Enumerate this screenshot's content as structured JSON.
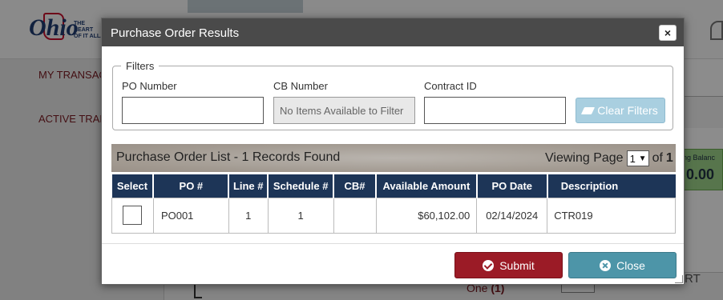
{
  "background": {
    "logo": {
      "wordmark": "Ohio",
      "tagline_lines": [
        "THE",
        "HEART",
        "OF IT ALL."
      ]
    },
    "nav_items": [
      "MY TRANSAC",
      "ACTIVE TRAN"
    ],
    "right_card": {
      "title": "ng Balanc",
      "value": "0.00"
    },
    "bottom": {
      "one_label": "One",
      "one_count": "(1)",
      "art_text": "ART"
    }
  },
  "modal": {
    "title": "Purchase Order Results",
    "close_symbol": "×",
    "filters": {
      "legend": "Filters",
      "po_number": {
        "label": "PO Number",
        "value": "",
        "placeholder": ""
      },
      "cb_number": {
        "label": "CB Number",
        "value": "No Items Available to Filter"
      },
      "contract_id": {
        "label": "Contract ID",
        "value": "",
        "placeholder": ""
      },
      "clear_button": "Clear Filters"
    },
    "list": {
      "title": "Purchase Order List - 1 Records Found",
      "viewing_label": "Viewing Page",
      "page_value": "1",
      "of_label": "of",
      "total_pages": "1"
    },
    "table": {
      "columns": [
        "Select",
        "PO #",
        "Line #",
        "Schedule #",
        "CB#",
        "Available Amount",
        "PO Date",
        "Description"
      ],
      "rows": [
        {
          "po": "PO001",
          "line": "1",
          "schedule": "1",
          "cb": "",
          "amount": "$60,102.00",
          "date": "02/14/2024",
          "description": "CTR019"
        }
      ]
    },
    "buttons": {
      "submit": "Submit",
      "close": "Close"
    }
  },
  "colors": {
    "header": "#4a4a4a",
    "table_header": "#1d3557",
    "submit": "#9b1b26",
    "close": "#4d95a8",
    "clear_filters": "#a9cfe0"
  }
}
